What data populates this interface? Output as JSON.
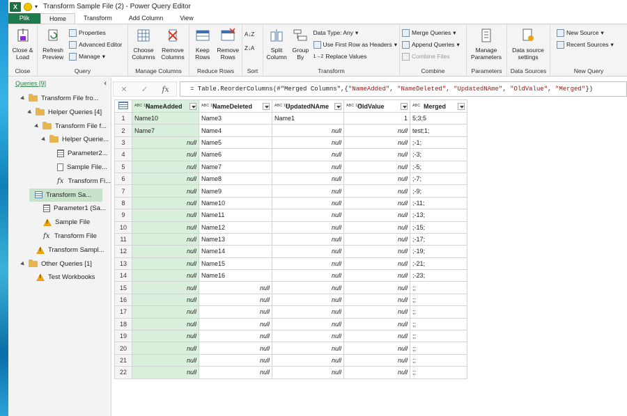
{
  "window": {
    "title": "Transform Sample File (2) - Power Query Editor",
    "app_logo": "X"
  },
  "tabs": [
    "Plik",
    "Home",
    "Transform",
    "Add Column",
    "View"
  ],
  "ribbon": {
    "close": {
      "label": "Close & Load",
      "group": "Close"
    },
    "query": {
      "refresh": "Refresh Preview",
      "properties": "Properties",
      "advanced": "Advanced Editor",
      "manage": "Manage",
      "group": "Query"
    },
    "manage_columns": {
      "choose": "Choose Columns",
      "remove": "Remove Columns",
      "group": "Manage Columns"
    },
    "reduce_rows": {
      "keep": "Keep Rows",
      "remove": "Remove Rows",
      "group": "Reduce Rows"
    },
    "sort": {
      "group": "Sort"
    },
    "transform": {
      "split": "Split Column",
      "group_by": "Group By",
      "data_type": "Data Type: Any",
      "first_row": "Use First Row as Headers",
      "replace": "Replace Values",
      "group": "Transform"
    },
    "combine": {
      "merge": "Merge Queries",
      "append": "Append Queries",
      "files": "Combine Files",
      "group": "Combine"
    },
    "parameters": {
      "manage": "Manage Parameters",
      "group": "Parameters"
    },
    "data_sources": {
      "settings": "Data source settings",
      "group": "Data Sources"
    },
    "new_query": {
      "new_source": "New Source",
      "recent": "Recent Sources",
      "group": "New Query"
    }
  },
  "queries": {
    "header": "Queries [9]",
    "items": [
      {
        "label": "Transform File fro...",
        "icon": "folder",
        "indent": 0,
        "expander": true
      },
      {
        "label": "Helper Queries [4]",
        "icon": "folder",
        "indent": 1,
        "expander": true
      },
      {
        "label": "Transform File f...",
        "icon": "folder",
        "indent": 2,
        "expander": true
      },
      {
        "label": "Helper Querie...",
        "icon": "folder",
        "indent": 3,
        "expander": true
      },
      {
        "label": "Parameter2...",
        "icon": "param",
        "indent": 4
      },
      {
        "label": "Sample File...",
        "icon": "doc",
        "indent": 4
      },
      {
        "label": "Transform Fi...",
        "icon": "fx",
        "indent": 4
      },
      {
        "label": "Transform Sa...",
        "icon": "table",
        "indent": 3,
        "selected": true
      },
      {
        "label": "Parameter1 (Sa...",
        "icon": "param",
        "indent": 2
      },
      {
        "label": "Sample File",
        "icon": "warn",
        "indent": 2
      },
      {
        "label": "Transform File",
        "icon": "fx",
        "indent": 2
      },
      {
        "label": "Transform Sampl...",
        "icon": "warn",
        "indent": 1
      },
      {
        "label": "Other Queries [1]",
        "icon": "folder",
        "indent": 0,
        "expander": true
      },
      {
        "label": "Test Workbooks",
        "icon": "warn",
        "indent": 1
      }
    ]
  },
  "formula": {
    "prefix": "= Table.ReorderColumns(#\"Merged Columns\",{",
    "parts": [
      "\"NameAdded\"",
      "\"NameDeleted\"",
      "\"UpdatedNAme\"",
      "\"OldValue\"",
      "\"Merged\""
    ],
    "suffix": "})"
  },
  "table": {
    "columns": [
      {
        "name": "NameAdded",
        "type": "ABC 123"
      },
      {
        "name": "NameDeleted",
        "type": "ABC 123"
      },
      {
        "name": "UpdatedNAme",
        "type": "ABC 123"
      },
      {
        "name": "OldValue",
        "type": "ABC 123"
      },
      {
        "name": "Merged",
        "type": "ABC"
      }
    ],
    "rows": [
      [
        "Name10",
        "Name3",
        "Name1",
        "1",
        "5;3;5"
      ],
      [
        "Name7",
        "Name4",
        "null",
        "null",
        "test;1;"
      ],
      [
        "null",
        "Name5",
        "null",
        "null",
        ";-1;"
      ],
      [
        "null",
        "Name6",
        "null",
        "null",
        ";-3;"
      ],
      [
        "null",
        "Name7",
        "null",
        "null",
        ";-5;"
      ],
      [
        "null",
        "Name8",
        "null",
        "null",
        ";-7;"
      ],
      [
        "null",
        "Name9",
        "null",
        "null",
        ";-9;"
      ],
      [
        "null",
        "Name10",
        "null",
        "null",
        ";-11;"
      ],
      [
        "null",
        "Name11",
        "null",
        "null",
        ";-13;"
      ],
      [
        "null",
        "Name12",
        "null",
        "null",
        ";-15;"
      ],
      [
        "null",
        "Name13",
        "null",
        "null",
        ";-17;"
      ],
      [
        "null",
        "Name14",
        "null",
        "null",
        ";-19;"
      ],
      [
        "null",
        "Name15",
        "null",
        "null",
        ";-21;"
      ],
      [
        "null",
        "Name16",
        "null",
        "null",
        ";-23;"
      ],
      [
        "null",
        "null",
        "null",
        "null",
        ";;"
      ],
      [
        "null",
        "null",
        "null",
        "null",
        ";;"
      ],
      [
        "null",
        "null",
        "null",
        "null",
        ";;"
      ],
      [
        "null",
        "null",
        "null",
        "null",
        ";;"
      ],
      [
        "null",
        "null",
        "null",
        "null",
        ";;"
      ],
      [
        "null",
        "null",
        "null",
        "null",
        ";;"
      ],
      [
        "null",
        "null",
        "null",
        "null",
        ";;"
      ],
      [
        "null",
        "null",
        "null",
        "null",
        ";;"
      ]
    ]
  }
}
